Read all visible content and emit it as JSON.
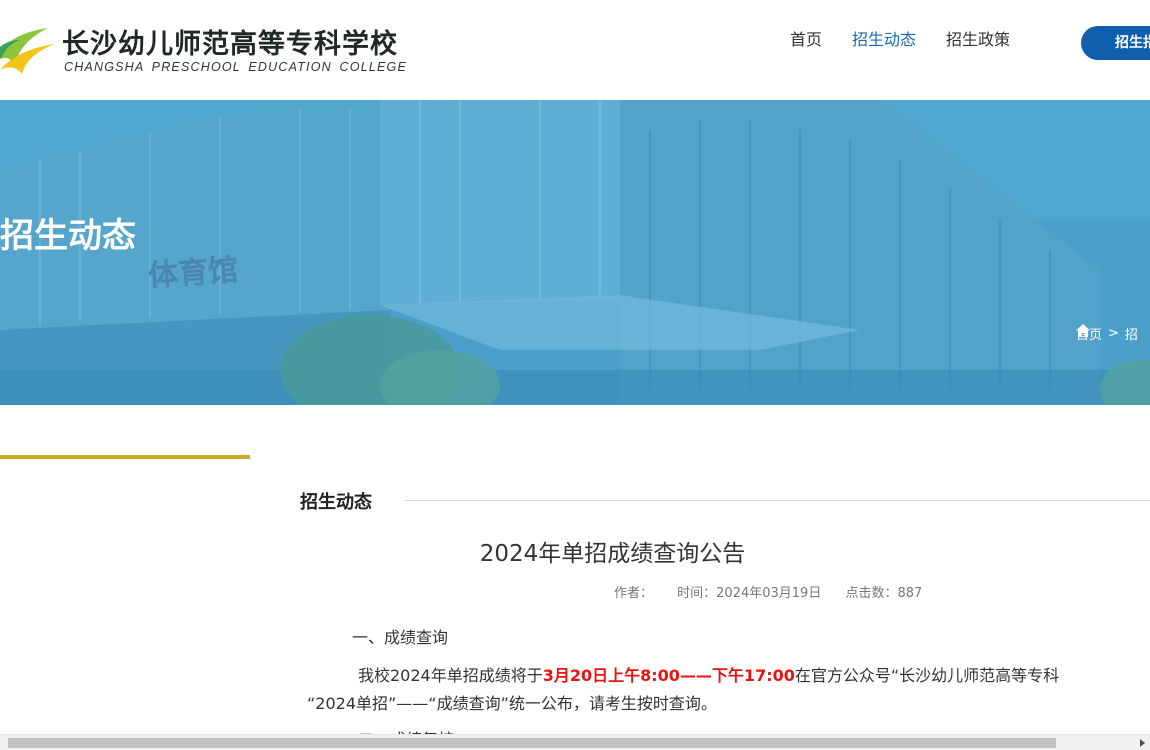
{
  "header": {
    "logo_cn": "长沙幼儿师范高等专科学校",
    "logo_en": "CHANGSHA PRESCHOOL EDUCATION COLLEGE",
    "nav": [
      {
        "label": "首页"
      },
      {
        "label": "招生动态"
      },
      {
        "label": "招生政策"
      }
    ],
    "cta_label": "招生指南"
  },
  "banner": {
    "title": "招生动态",
    "building_sign": "体育馆",
    "breadcrumb_home": "首页",
    "breadcrumb_sep": ">",
    "breadcrumb_next": "招"
  },
  "content": {
    "section_title": "招生动态",
    "article_title": "2024年单招成绩查询公告",
    "meta": {
      "author_label": "作者：",
      "time_label": "时间：2024年03月19日",
      "views_label": "点击数：887"
    },
    "heading1": "一、成绩查询",
    "para1_pre": "我校2024年单招成绩将于",
    "para1_red": "3月20日上午8:00——下午17:00",
    "para1_post": "在官方公众号“长沙幼儿师范高等专科",
    "para2": "“2024单招”——“成绩查询”统一公布，请考生按时查询。",
    "heading2": "二、成绩复核"
  },
  "colors": {
    "accent": "#1a6ab2",
    "cta": "#0f5fae",
    "gold": "#c8a92c",
    "highlight": "#e8140f"
  }
}
